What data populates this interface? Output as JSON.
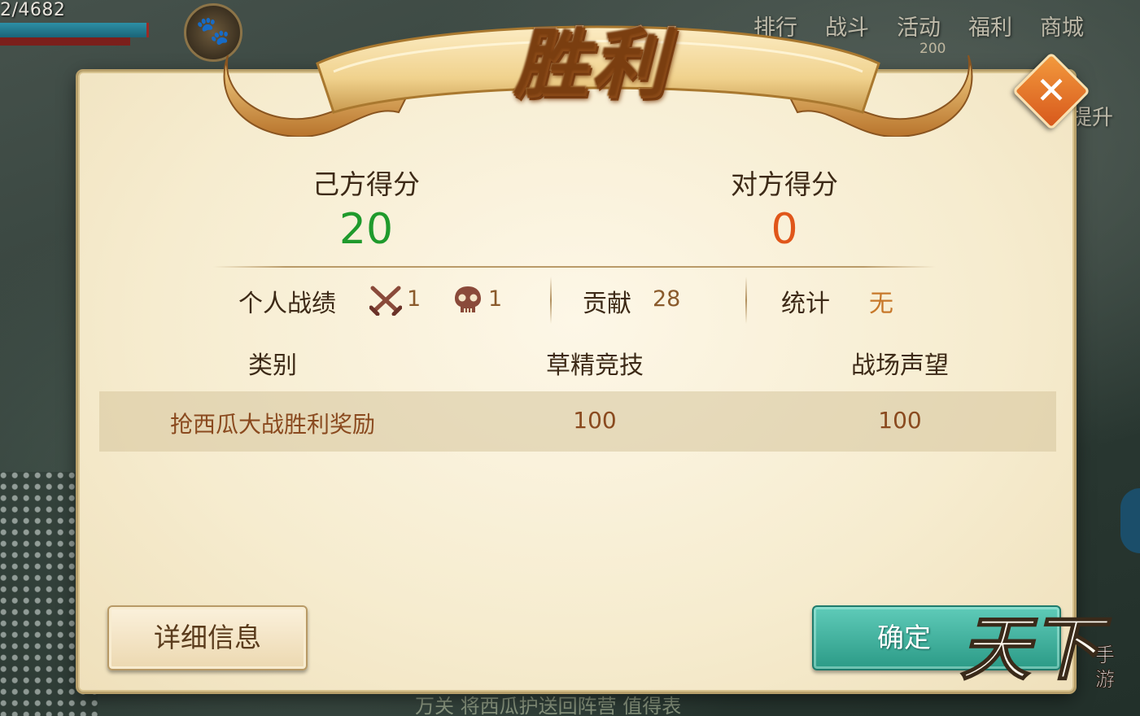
{
  "hud": {
    "hp_text": "2/4682",
    "top_menu": [
      "排行",
      "战斗",
      "活动",
      "福利",
      "商城"
    ],
    "activity_badge": "200",
    "upgrade_label": "提升",
    "chat_text": "万关  将西瓜护送回阵营  值得表"
  },
  "dialog": {
    "title": "胜利",
    "close_label": "✕",
    "my_score_label": "己方得分",
    "my_score_value": "20",
    "enemy_score_label": "对方得分",
    "enemy_score_value": "0",
    "personal_record_label": "个人战绩",
    "kills": "1",
    "deaths": "1",
    "contribution_label": "贡献",
    "contribution_value": "28",
    "stats_label": "统计",
    "stats_value": "无",
    "table": {
      "headers": [
        "类别",
        "草精竞技",
        "战场声望"
      ],
      "rows": [
        [
          "抢西瓜大战胜利奖励",
          "100",
          "100"
        ]
      ]
    },
    "detail_button": "详细信息",
    "confirm_button": "确定"
  },
  "logo": {
    "text_main": "天下",
    "text_sub": "手游"
  },
  "colors": {
    "my_score": "#1f9a2c",
    "enemy_score": "#e0561a",
    "confirm_button": "#2b9a86",
    "close_button": "#d7581c"
  }
}
